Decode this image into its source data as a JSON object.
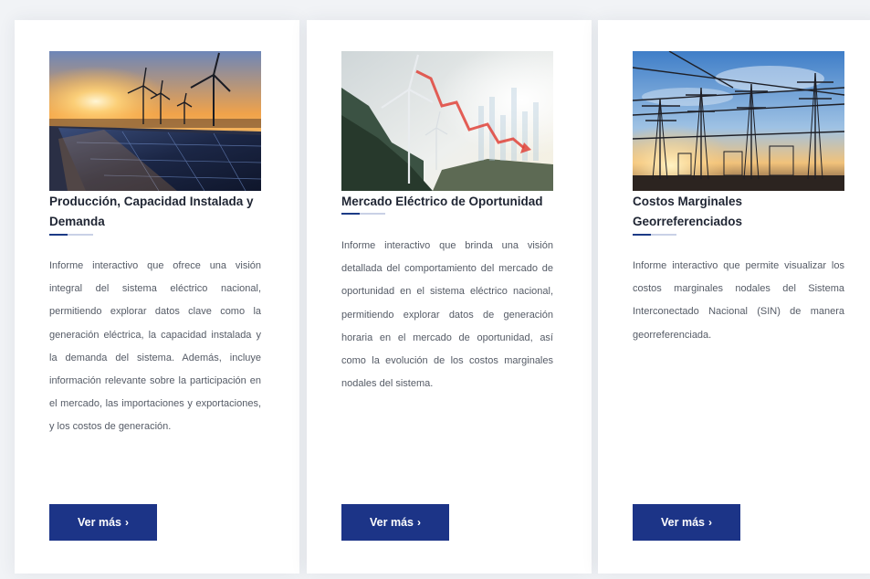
{
  "cards": [
    {
      "title": "Producción, Capacidad Instalada y Demanda",
      "description": "Informe interactivo que ofrece una visión integral del sistema eléctrico nacional, permitiendo explorar datos clave como la generación eléctrica, la capacidad instalada y la demanda del sistema. Además, incluye información relevante sobre la participación en el mercado, las importaciones y exportaciones, y los costos de generación.",
      "button_label": "Ver más",
      "button_icon": "chevron-right-icon"
    },
    {
      "title": "Mercado Eléctrico de Oportunidad",
      "description": "Informe interactivo que brinda una visión detallada del comportamiento del mercado de oportunidad en el sistema eléctrico nacional, permitiendo explorar datos de generación horaria en el mercado de oportunidad, así como la evolución de los costos marginales nodales del sistema.",
      "button_label": "Ver más",
      "button_icon": "chevron-right-icon"
    },
    {
      "title": "Costos Marginales Georreferenciados",
      "description": "Informe interactivo que permite visualizar los costos marginales nodales del Sistema Interconectado Nacional (SIN) de manera georreferenciada.",
      "button_label": "Ver más",
      "button_icon": "chevron-right-icon"
    }
  ],
  "colors": {
    "button_bg": "#1c3487",
    "accent_line": "#1c3b86",
    "title_text": "#1f2533",
    "body_text": "#555b66"
  }
}
